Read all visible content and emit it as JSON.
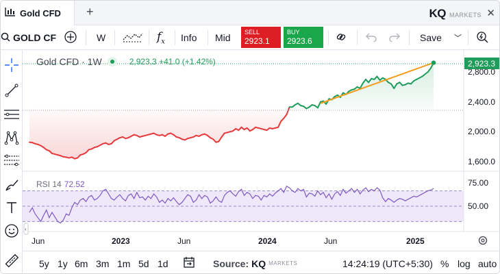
{
  "tab": {
    "label": "Gold CFD",
    "icon": "candle-chart-icon"
  },
  "brand": {
    "kq": "KQ",
    "sub": "MARKETS"
  },
  "toolbar": {
    "symbol": "GOLD CF",
    "interval": "W",
    "info_label": "Info",
    "mid_label": "Mid",
    "sell_label": "SELL",
    "sell_price": "2923.1",
    "buy_label": "BUY",
    "buy_price": "2923.6",
    "save_label": "Save"
  },
  "legend": {
    "symbol": "Gold CFD · 1W",
    "last": "2,923.3",
    "change": "+41.0 (+1.42%)"
  },
  "rsi": {
    "label": "RSI 14",
    "value": "72.52"
  },
  "price_axis": {
    "ticks": [
      "2,800.0",
      "2,400.0",
      "2,000.0",
      "1,600.0"
    ],
    "last_badge": "2,923.3"
  },
  "rsi_axis": {
    "ticks": [
      "75.00",
      "50.00"
    ]
  },
  "time_axis": {
    "ticks": [
      "Jun",
      "2023",
      "Jun",
      "2024",
      "Jun",
      "2025"
    ]
  },
  "bottombar": {
    "ranges": [
      "5y",
      "1y",
      "6m",
      "3m",
      "1m",
      "5d",
      "1d"
    ],
    "source_label": "Source:",
    "source_kq": "KQ",
    "source_sub": "MARKETS",
    "clock": "14:24:19 (UTC+5:30)",
    "pct": "%",
    "log": "log",
    "auto": "auto"
  },
  "colors": {
    "up": "#1f9b5a",
    "down": "#e5393c",
    "trendline": "#f59a1c",
    "rsi_line": "#7e57c2",
    "rsi_band": "#efe8fb",
    "sell": "#dd1e25",
    "buy": "#1aa64a"
  },
  "chart_data": {
    "type": "line",
    "ylim": [
      1500,
      3000
    ],
    "baseline": 2300,
    "series": [
      {
        "values": [
          1860,
          1855,
          1840,
          1830,
          1815,
          1790,
          1760,
          1745,
          1710,
          1700,
          1690,
          1680,
          1665,
          1660,
          1650,
          1660,
          1640,
          1650,
          1690,
          1700,
          1720,
          1760,
          1770,
          1790,
          1800,
          1820,
          1840,
          1850,
          1830,
          1840,
          1880,
          1900,
          1920,
          1930,
          1910,
          1920,
          1940,
          1960,
          1950,
          1930,
          1940,
          1950,
          1960,
          1970,
          1980,
          1960,
          1950,
          1960,
          1940,
          1970,
          1980,
          1960,
          1930,
          1920,
          1900,
          1890,
          1910,
          1920,
          1930,
          1950,
          1940,
          1960,
          1970,
          1950,
          1920,
          1900,
          1860,
          1870,
          1930,
          1980,
          1990,
          2000,
          2010,
          2040,
          2020,
          2060,
          2030,
          2050,
          2010,
          2030,
          2060,
          2050,
          2040,
          2030,
          2020,
          2050,
          2040,
          2050,
          2060,
          2140,
          2180,
          2230,
          2330,
          2330,
          2360,
          2380,
          2350,
          2340,
          2310,
          2330,
          2360,
          2350,
          2320,
          2400,
          2410,
          2370,
          2440,
          2430,
          2470,
          2490,
          2460,
          2520,
          2500,
          2540,
          2560,
          2570,
          2600,
          2580,
          2650,
          2700,
          2660,
          2710,
          2700,
          2740,
          2690,
          2720,
          2700,
          2660,
          2640,
          2580,
          2640,
          2660,
          2620,
          2630,
          2650,
          2640,
          2680,
          2700,
          2720,
          2740,
          2770,
          2800,
          2850,
          2923
        ]
      },
      {
        "values": [
          42,
          48,
          40,
          35,
          30,
          38,
          45,
          35,
          42,
          36,
          30,
          28,
          32,
          40,
          38,
          48,
          55,
          52,
          58,
          60,
          56,
          62,
          64,
          58,
          60,
          64,
          70,
          72,
          66,
          60,
          58,
          62,
          65,
          60,
          57,
          64,
          66,
          60,
          68,
          61,
          62,
          58,
          63,
          60,
          66,
          62,
          55,
          58,
          54,
          60,
          57,
          61,
          56,
          52,
          55,
          60,
          65,
          63,
          55,
          58,
          65,
          60,
          64,
          62,
          54,
          57,
          62,
          57,
          55,
          64,
          68,
          70,
          66,
          63,
          69,
          72,
          64,
          68,
          66,
          60,
          64,
          63,
          58,
          64,
          62,
          66,
          63,
          67,
          70,
          73,
          68,
          76,
          74,
          70,
          68,
          73,
          70,
          72,
          62,
          67,
          66,
          63,
          70,
          65,
          68,
          61,
          66,
          59,
          66,
          69,
          64,
          72,
          67,
          70,
          73,
          68,
          72,
          66,
          71,
          74,
          69,
          72,
          70,
          74,
          71,
          61,
          56,
          60,
          58,
          55,
          58,
          60,
          59,
          57,
          59,
          61,
          63,
          62,
          64,
          66,
          68,
          70,
          71,
          73
        ]
      }
    ]
  }
}
